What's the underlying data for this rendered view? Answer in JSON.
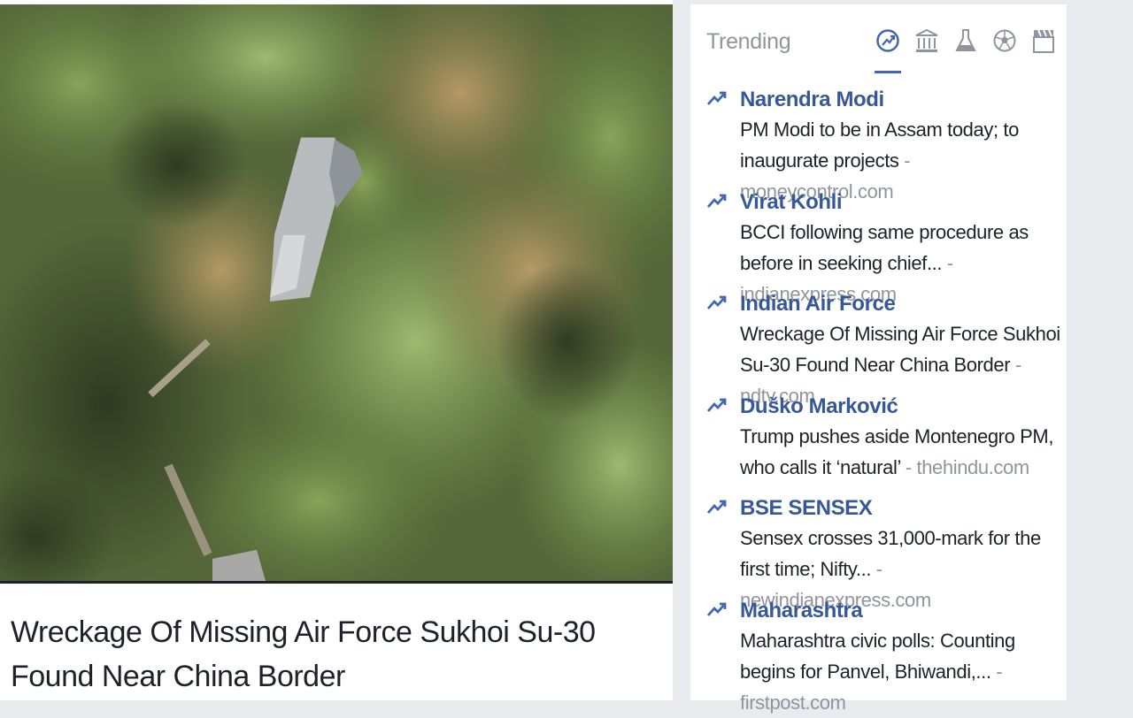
{
  "story": {
    "headline": "Wreckage Of Missing Air Force Sukhoi Su-30 Found Near China Border",
    "photo_icon": "aerial-forest-wreckage-photo"
  },
  "trending": {
    "header": "Trending",
    "categories": [
      {
        "icon": "trending-up-icon",
        "active": true
      },
      {
        "icon": "politics-building-icon",
        "active": false
      },
      {
        "icon": "science-flask-icon",
        "active": false
      },
      {
        "icon": "sports-ball-icon",
        "active": false
      },
      {
        "icon": "entertainment-clapper-icon",
        "active": false
      }
    ],
    "topics": [
      {
        "name": "Narendra Modi",
        "desc": "PM Modi to be in Assam today; to inaugurate projects",
        "source": "moneycontrol.com"
      },
      {
        "name": "Virat Kohli",
        "desc": "BCCI following same procedure as before in seeking chief...",
        "source": "indianexpress.com"
      },
      {
        "name": "Indian Air Force",
        "desc": "Wreckage Of Missing Air Force Sukhoi Su-30 Found Near China Border",
        "source": "ndtv.com"
      },
      {
        "name": "Duško Marković",
        "desc": "Trump pushes aside Montenegro PM, who calls it ‘natural’",
        "source": "thehindu.com"
      },
      {
        "name": "BSE SENSEX",
        "desc": "Sensex crosses 31,000-mark for the first time; Nifty...",
        "source": "newindianexpress.com"
      },
      {
        "name": "Maharashtra",
        "desc": "Maharashtra civic polls: Counting begins for Panvel, Bhiwandi,...",
        "source": "firstpost.com"
      }
    ],
    "separator": " - ",
    "colors": {
      "link": "#365899",
      "muted": "#90949c",
      "accent": "#4267b2"
    }
  }
}
